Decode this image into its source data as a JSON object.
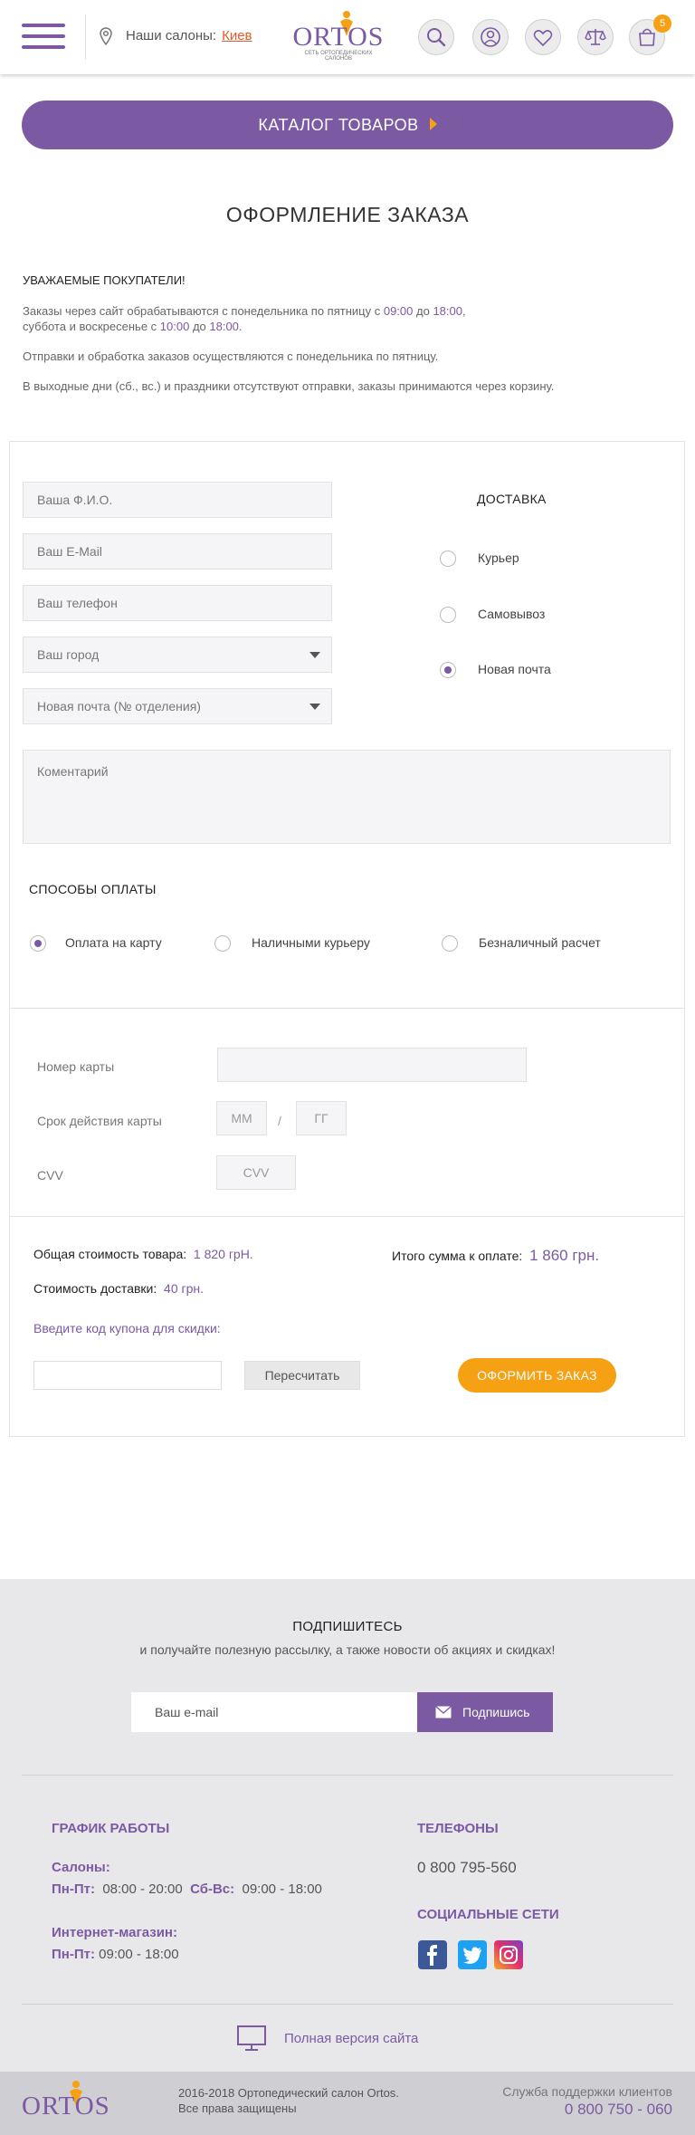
{
  "header": {
    "salons_label": "Наши салоны:",
    "city": "Киев",
    "logo_text": "ORTOS",
    "logo_tagline": "СЕТЬ ОРТОПЕДИЧЕСКИХ САЛОНОВ",
    "cart_count": "5"
  },
  "catalog_button": "КАТАЛОГ ТОВАРОВ",
  "page_title": "ОФОРМЛЕНИЕ ЗАКАЗА",
  "notice": {
    "heading": "УВАЖАЕМЫЕ ПОКУПАТЕЛИ!",
    "line1_a": "Заказы через сайт обрабатываются с понедельника по пятницу с ",
    "time1": "09:00",
    "line1_b": " до ",
    "time2": "18:00",
    "line1_c": ",",
    "line2_a": "суббота и воскресенье с ",
    "time3": "10:00",
    "line2_b": " до ",
    "time4": "18:00",
    "line2_c": ".",
    "para2": "Отправки и обработка заказов осуществляются с понедельника по пятницу.",
    "para3": "В выходные дни (сб., вс.) и праздники отсутствуют отправки, заказы принимаются через корзину."
  },
  "form": {
    "name_placeholder": "Ваша Ф.И.О.",
    "email_placeholder": "Ваш E-Mail",
    "phone_placeholder": "Ваш телефон",
    "city_select": "Ваш город",
    "branch_select": "Новая почта (№ отделения)",
    "comment_placeholder": "Коментарий"
  },
  "delivery": {
    "title": "ДОСТАВКА",
    "options": [
      "Курьер",
      "Самовывоз",
      "Новая почта"
    ],
    "selected": "Новая почта"
  },
  "payment": {
    "title": "СПОСОБЫ ОПЛАТЫ",
    "options": [
      "Оплата на карту",
      "Наличными курьеру",
      "Безналичный расчет"
    ],
    "selected": "Оплата на карту"
  },
  "card": {
    "number_label": "Номер карты",
    "expiry_label": "Срок действия карты",
    "month_placeholder": "ММ",
    "separator": "/",
    "year_placeholder": "ГГ",
    "cvv_label": "CVV",
    "cvv_placeholder": "CVV"
  },
  "totals": {
    "goods_label": "Общая стоимость товара:",
    "goods_value": "1 820 грН.",
    "delivery_label": "Стоимость доставки:",
    "delivery_value": "40 грн.",
    "total_label": "Итого сумма к оплате:",
    "total_value": "1 860 грн.",
    "coupon_label": "Введите код купона для скидки:",
    "recalc_button": "Пересчитать",
    "order_button": "ОФОРМИТЬ ЗАКАЗ"
  },
  "subscribe": {
    "title": "ПОДПИШИТЕСЬ",
    "text": "и получайте полезную рассылку, а также новости об акциях и скидках!",
    "email_placeholder": "Ваш e-mail",
    "button": "Подпишись"
  },
  "schedule": {
    "title": "ГРАФИК РАБОТЫ",
    "salons_label": "Салоны:",
    "weekdays_label": "Пн-Пт:",
    "weekdays_hours": "08:00 - 20:00",
    "weekend_label": "Сб-Вс:",
    "weekend_hours": "09:00 - 18:00",
    "shop_label": "Интернет-магазин:",
    "shop_days_label": "Пн-Пт:",
    "shop_hours": "09:00 - 18:00"
  },
  "phones": {
    "title": "ТЕЛЕФОНЫ",
    "phone": "0 800 795-560",
    "social_title": "СОЦИАЛЬНЫЕ СЕТИ"
  },
  "full_version": "Полная версия сайта",
  "bottom": {
    "copyright_line1": "2016-2018  Ортопедический салон Ortos.",
    "copyright_line2": "Все права защищены",
    "support_label": "Служба поддержки клиентов",
    "support_phone": "0 800 750 - 060"
  },
  "colors": {
    "brand_purple": "#7b5aa3",
    "accent_orange": "#f6a014",
    "city_link": "#e35b2c"
  }
}
